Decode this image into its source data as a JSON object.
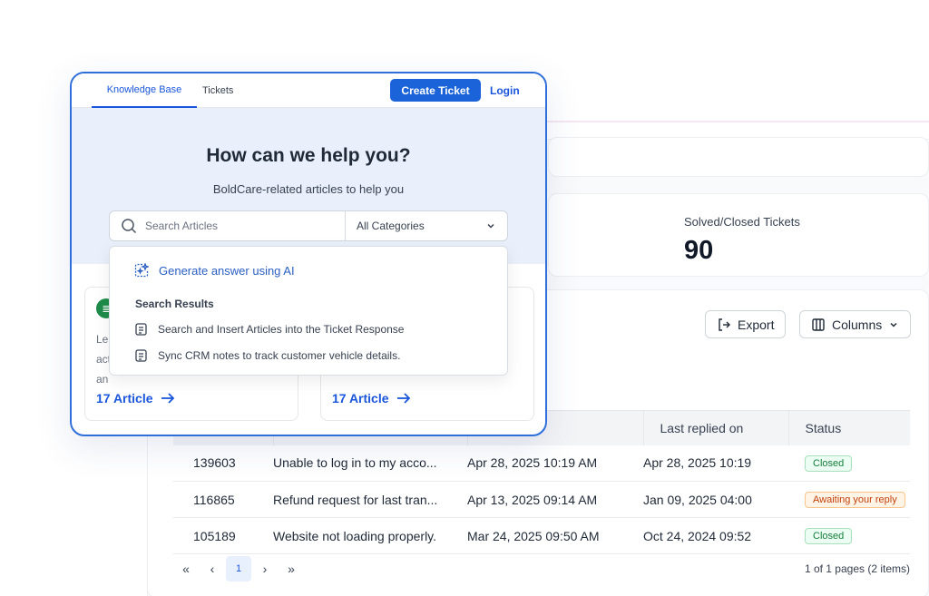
{
  "nav": {
    "tabs": [
      "Knowledge Base",
      "Tickets"
    ],
    "create_ticket_label": "Create Ticket",
    "login_label": "Login"
  },
  "hero": {
    "title": "How can we help you?",
    "subtitle": "BoldCare-related articles to help you"
  },
  "search": {
    "placeholder": "Search Articles",
    "category_selected": "All Categories"
  },
  "dropdown": {
    "ai_label": "Generate answer using AI",
    "results_heading": "Search Results",
    "results": [
      "Search and Insert Articles into the Ticket Response",
      "Sync CRM notes to track customer vehicle details."
    ]
  },
  "article_cards": [
    {
      "text_fragments": [
        "Le",
        "act",
        "an"
      ],
      "link_label": "17 Article"
    },
    {
      "link_label": "17 Article"
    }
  ],
  "stats": {
    "label": "Solved/Closed Tickets",
    "value": "90"
  },
  "toolbar": {
    "export_label": "Export",
    "columns_label": "Columns"
  },
  "table": {
    "columns": [
      "Last replied on",
      "Status"
    ],
    "rows": [
      {
        "id": "139603",
        "subject": "Unable to log in to my acco...",
        "created": "Apr 28, 2025 10:19 AM",
        "replied": "Apr 28, 2025 10:19",
        "status": "Closed"
      },
      {
        "id": "116865",
        "subject": "Refund request for last tran...",
        "created": "Apr 13, 2025 09:14 AM",
        "replied": "Jan 09, 2025 04:00",
        "status": "Awaiting your reply"
      },
      {
        "id": "105189",
        "subject": "Website not loading properly.",
        "created": "Mar 24, 2025 09:50 AM",
        "replied": "Oct 24, 2024 09:52",
        "status": "Closed"
      }
    ]
  },
  "pagination": {
    "first": "«",
    "prev": "‹",
    "current": "1",
    "next": "›",
    "last": "»",
    "info": "1 of 1 pages (2 items)"
  },
  "colors": {
    "accent": "#1a63d8",
    "hero_bg": "#e9f0fb",
    "closed": "#16803c",
    "awaiting": "#c2410c"
  }
}
